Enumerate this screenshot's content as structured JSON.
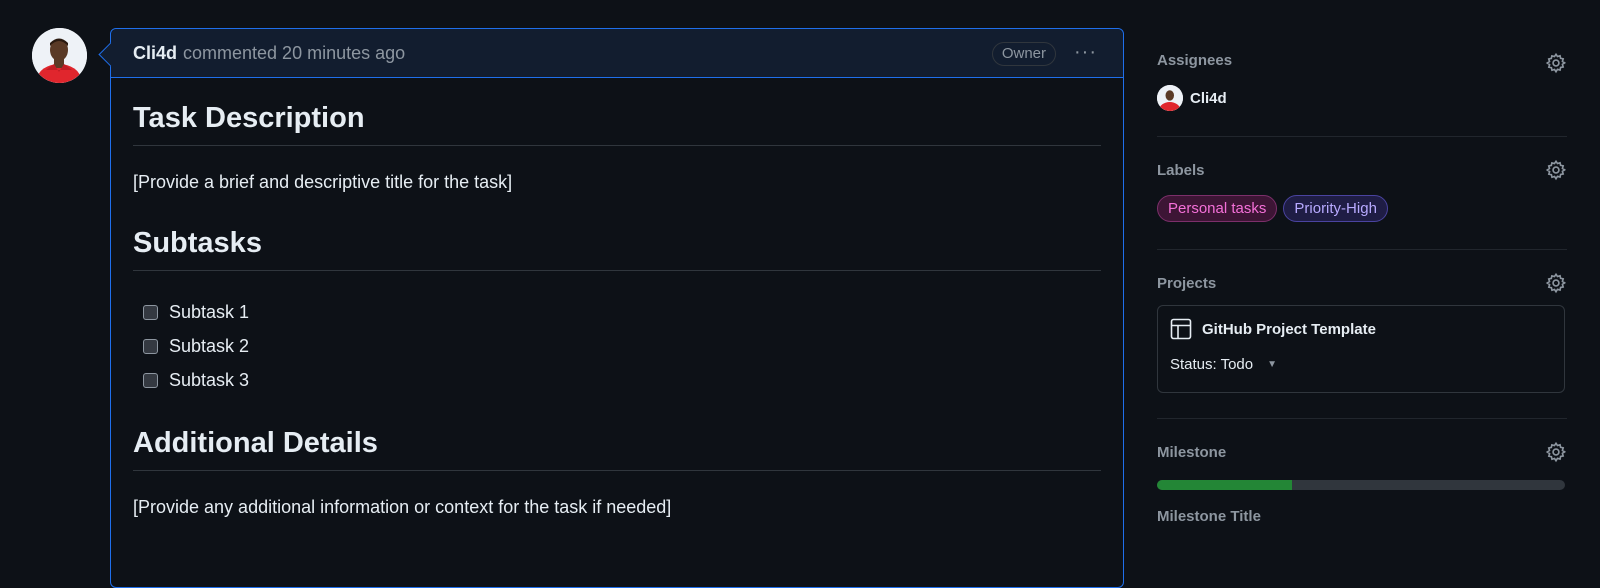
{
  "comment": {
    "author": "Cli4d",
    "meta": "commented 20 minutes ago",
    "badge": "Owner",
    "menu_glyph": "···",
    "body": {
      "heading_task": "Task Description",
      "task_text": "[Provide a brief and descriptive title for the task]",
      "heading_subtasks": "Subtasks",
      "subtasks": [
        {
          "label": "Subtask 1",
          "checked": false
        },
        {
          "label": "Subtask 2",
          "checked": false
        },
        {
          "label": "Subtask 3",
          "checked": false
        }
      ],
      "heading_additional": "Additional Details",
      "additional_text": "[Provide any additional information or context for the task if needed]"
    }
  },
  "sidebar": {
    "assignees": {
      "title": "Assignees",
      "user": "Cli4d",
      "icon": "gear-icon"
    },
    "labels": {
      "title": "Labels",
      "items": [
        {
          "text": "Personal tasks",
          "color": "#f470d8"
        },
        {
          "text": "Priority-High",
          "color": "#b7a9ff"
        }
      ]
    },
    "projects": {
      "title": "Projects",
      "project_name": "GitHub Project Template",
      "status": "Status: Todo"
    },
    "milestone": {
      "title": "Milestone",
      "progress_fraction": 0.33,
      "milestone_title": "Milestone Title"
    }
  },
  "colors": {
    "background": "#0d1117",
    "accent_border": "#1f6feb",
    "progress": "#238636"
  }
}
